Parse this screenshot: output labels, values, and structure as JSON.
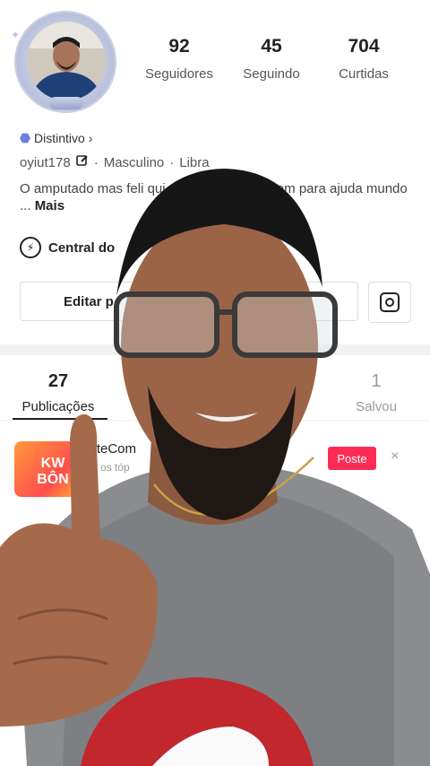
{
  "profile": {
    "stats": [
      {
        "value": "92",
        "label": "Seguidores"
      },
      {
        "value": "45",
        "label": "Seguindo"
      },
      {
        "value": "704",
        "label": "Curtidas"
      }
    ],
    "badge_label": "Distintivo",
    "badge_chevron": "›",
    "username": "oyiut178",
    "gender": "Masculino",
    "sign": "Libra",
    "separator": "·",
    "bio_visible": "O amputado mas feli                  qui no Brasil me seguem para ajuda                  mundo ...",
    "bio_more": "Mais"
  },
  "central_label": "Central do",
  "buttons": {
    "edit_label": "Editar p",
    "edit_trailing": "s",
    "instagram_icon": "instagram-icon"
  },
  "tabs": [
    {
      "count": "27",
      "label": "Publicações",
      "active": true
    },
    {
      "count": "1",
      "label": "Salvou",
      "active": false
    }
  ],
  "promo": {
    "icon_text": "KW\nBÔN",
    "title": "osteCom",
    "subtitle": "fira os tóp",
    "action_label": "Poste",
    "close_symbol": "×"
  },
  "colors": {
    "accent": "#fe2c55",
    "badge": "#6f7fdc"
  }
}
